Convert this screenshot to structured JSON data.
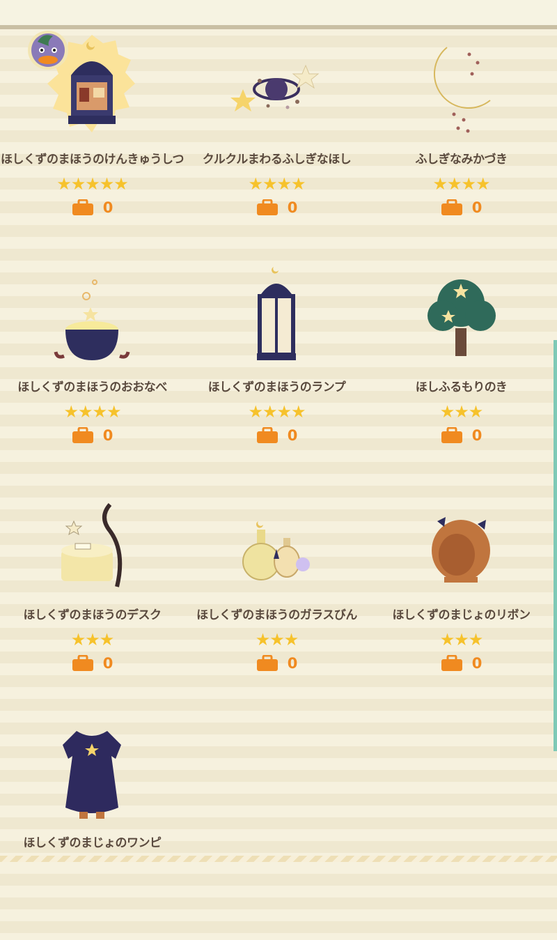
{
  "items": [
    {
      "name": "ほしくずのまほうのけんきゅうしつ",
      "stars": "★★★★★",
      "count": "0",
      "icon": "witch-study-room-icon",
      "highlighted": true
    },
    {
      "name": "クルクルまわるふしぎなほし",
      "stars": "★★★★",
      "count": "0",
      "icon": "spinning-planet-icon"
    },
    {
      "name": "ふしぎなみかづき",
      "stars": "★★★★",
      "count": "0",
      "icon": "crescent-moon-icon"
    },
    {
      "name": "ほしくずのまほうのおおなべ",
      "stars": "★★★★",
      "count": "0",
      "icon": "cauldron-icon"
    },
    {
      "name": "ほしくずのまほうのランプ",
      "stars": "★★★★",
      "count": "0",
      "icon": "lantern-icon"
    },
    {
      "name": "ほしふるもりのき",
      "stars": "★★★",
      "count": "0",
      "icon": "star-tree-icon"
    },
    {
      "name": "ほしくずのまほうのデスク",
      "stars": "★★★",
      "count": "0",
      "icon": "desk-icon"
    },
    {
      "name": "ほしくずのまほうのガラスびん",
      "stars": "★★★",
      "count": "0",
      "icon": "glass-bottles-icon"
    },
    {
      "name": "ほしくずのまじょのリボン",
      "stars": "★★★",
      "count": "0",
      "icon": "ribbon-hair-icon"
    },
    {
      "name": "ほしくずのまじょのワンピ",
      "stars": "",
      "count": "",
      "icon": "dress-icon"
    }
  ],
  "colors": {
    "star": "#f6c22c",
    "count": "#f08a20",
    "name": "#5a4a3e",
    "accent": "#7ec9b6"
  }
}
